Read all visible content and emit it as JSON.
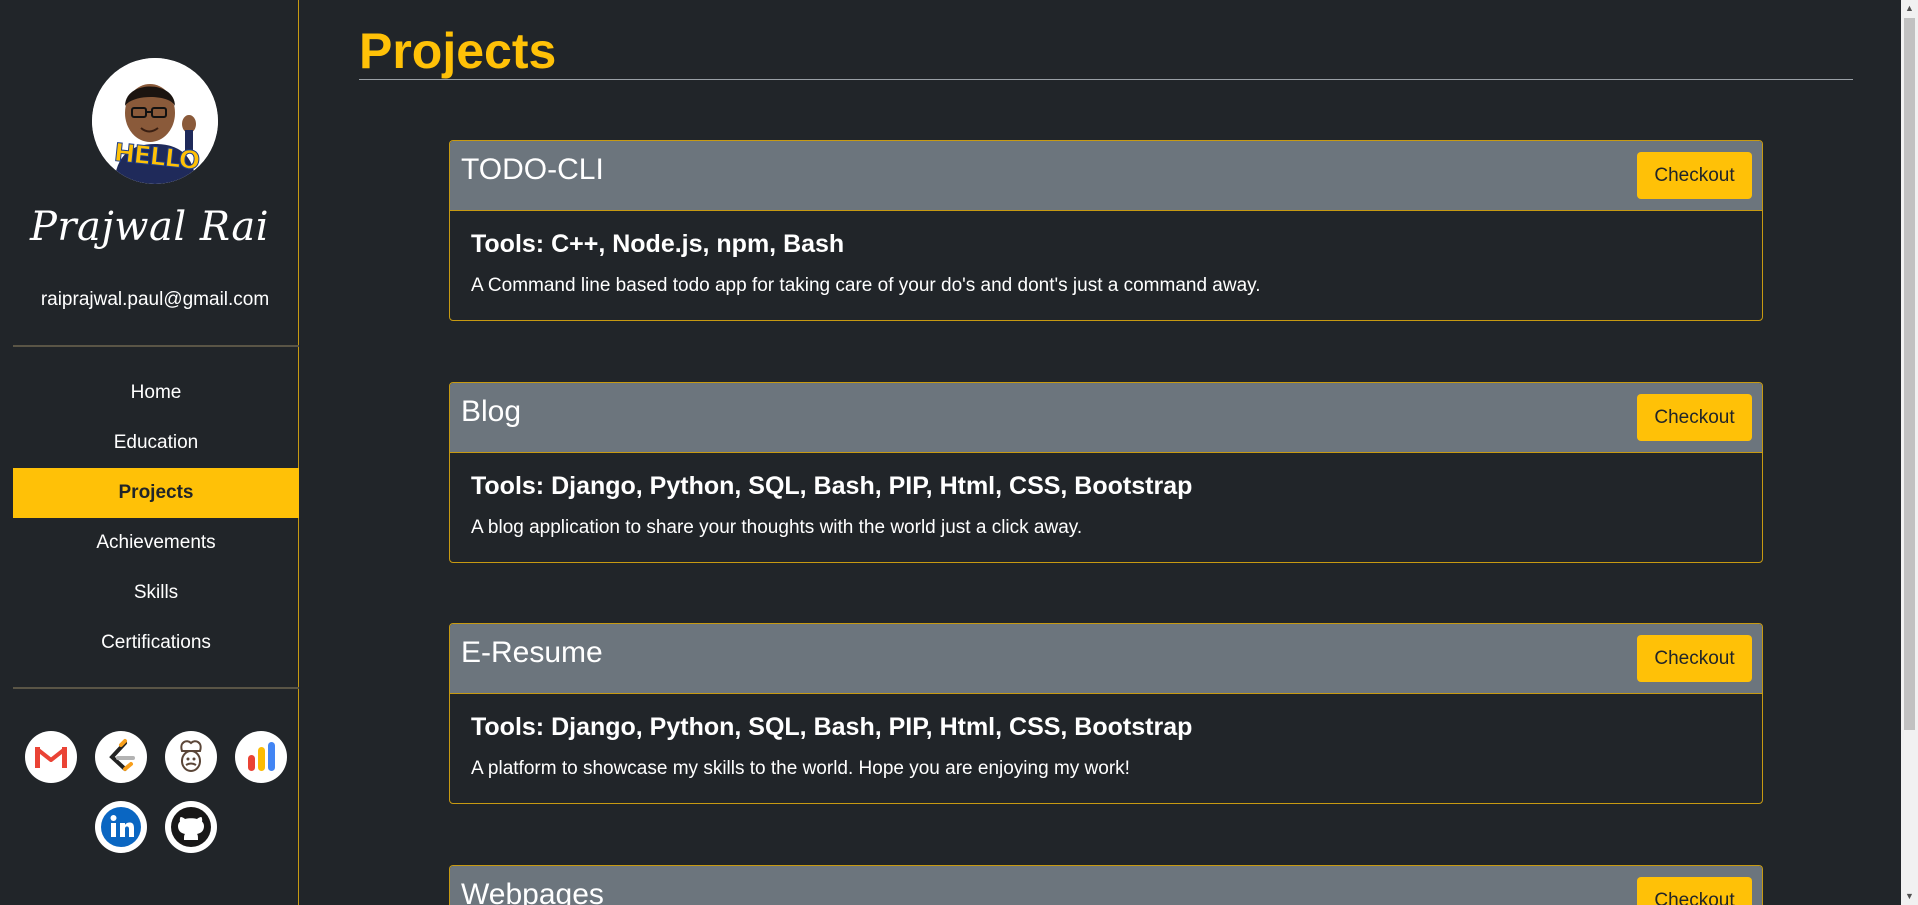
{
  "sidebar": {
    "avatar_text": "HELLO",
    "name": "Prajwal Rai",
    "email": "raiprajwal.paul@gmail.com",
    "nav": [
      {
        "label": "Home",
        "active": false
      },
      {
        "label": "Education",
        "active": false
      },
      {
        "label": "Projects",
        "active": true
      },
      {
        "label": "Achievements",
        "active": false
      },
      {
        "label": "Skills",
        "active": false
      },
      {
        "label": "Certifications",
        "active": false
      }
    ],
    "socials": [
      "gmail-icon",
      "leetcode-icon",
      "codechef-icon",
      "google-analytics-icon",
      "linkedin-icon",
      "github-icon"
    ]
  },
  "main": {
    "title": "Projects",
    "projects": [
      {
        "title": "TODO-CLI",
        "button": "Checkout",
        "tools": "Tools: C++, Node.js, npm, Bash",
        "description": "A Command line based todo app for taking care of your do's and dont's just a command away."
      },
      {
        "title": "Blog",
        "button": "Checkout",
        "tools": "Tools: Django, Python, SQL, Bash, PIP, Html, CSS, Bootstrap",
        "description": "A blog application to share your thoughts with the world just a click away."
      },
      {
        "title": "E-Resume",
        "button": "Checkout",
        "tools": "Tools: Django, Python, SQL, Bash, PIP, Html, CSS, Bootstrap",
        "description": "A platform to showcase my skills to the world. Hope you are enjoying my work!"
      },
      {
        "title": "Webpages",
        "button": "Checkout"
      }
    ]
  },
  "colors": {
    "background": "#212529",
    "accent": "#ffc107",
    "card_header": "#6c757d",
    "border": "#c79a12"
  }
}
